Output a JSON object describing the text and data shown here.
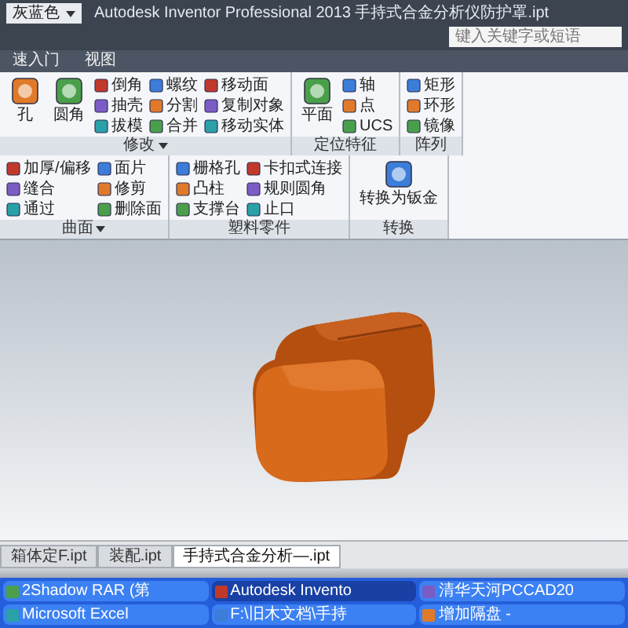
{
  "title_bar": {
    "color_scheme": "灰蓝色",
    "title": "Autodesk Inventor Professional 2013   手持式合金分析仪防护罩.ipt",
    "search": {
      "placeholder": "键入关键字或短语"
    }
  },
  "ribbon_tabs": [
    {
      "label": "速入门",
      "selected": false
    },
    {
      "label": "视图",
      "selected": false
    }
  ],
  "ribbon_panels": [
    {
      "title": "修改",
      "menu": true,
      "groups": [
        {
          "kind": "large",
          "items": [
            "孔",
            "圆角"
          ]
        },
        {
          "kind": "small",
          "items": [
            "倒角",
            "抽壳",
            "拔模"
          ]
        },
        {
          "kind": "small",
          "items": [
            "螺纹",
            "分割",
            "合并"
          ]
        },
        {
          "kind": "small",
          "items": [
            "移动面",
            "复制对象",
            "移动实体"
          ]
        }
      ]
    },
    {
      "title": "定位特征",
      "menu": false,
      "groups": [
        {
          "kind": "large",
          "items": [
            "平面"
          ]
        },
        {
          "kind": "small",
          "items": [
            "轴",
            "点",
            "UCS"
          ]
        }
      ]
    },
    {
      "title": "阵列",
      "menu": false,
      "groups": [
        {
          "kind": "small",
          "items": [
            "矩形",
            "环形",
            "镜像"
          ]
        }
      ]
    },
    {
      "title": "曲面",
      "menu": true,
      "groups": [
        {
          "kind": "small",
          "items": [
            "加厚/偏移",
            "缝合",
            "通过"
          ]
        },
        {
          "kind": "small",
          "items": [
            "面片",
            "修剪",
            "删除面"
          ]
        }
      ]
    },
    {
      "title": "塑料零件",
      "menu": false,
      "groups": [
        {
          "kind": "small",
          "items": [
            "栅格孔",
            "凸柱",
            "支撑台"
          ]
        },
        {
          "kind": "small",
          "items": [
            "卡扣式连接",
            "规则圆角",
            "止口"
          ]
        }
      ]
    },
    {
      "title": "转换",
      "menu": false,
      "groups": [
        {
          "kind": "large",
          "items": [
            "转换为钣金"
          ]
        }
      ]
    }
  ],
  "document_tabs": [
    {
      "label": "箱体定F.ipt",
      "selected": false
    },
    {
      "label": "装配.ipt",
      "selected": false
    },
    {
      "label": "手持式合金分析—.ipt",
      "selected": true
    }
  ],
  "taskbar": {
    "items": [
      {
        "label": "2Shadow RAR (第",
        "active": false
      },
      {
        "label": "Autodesk Invento",
        "active": true
      },
      {
        "label": "清华天河PCCAD20",
        "active": false
      },
      {
        "label": "Microsoft Excel",
        "active": false
      },
      {
        "label": "F:\\旧木文档\\手持",
        "active": false
      },
      {
        "label": "增加隔盘 -",
        "active": false
      }
    ]
  }
}
